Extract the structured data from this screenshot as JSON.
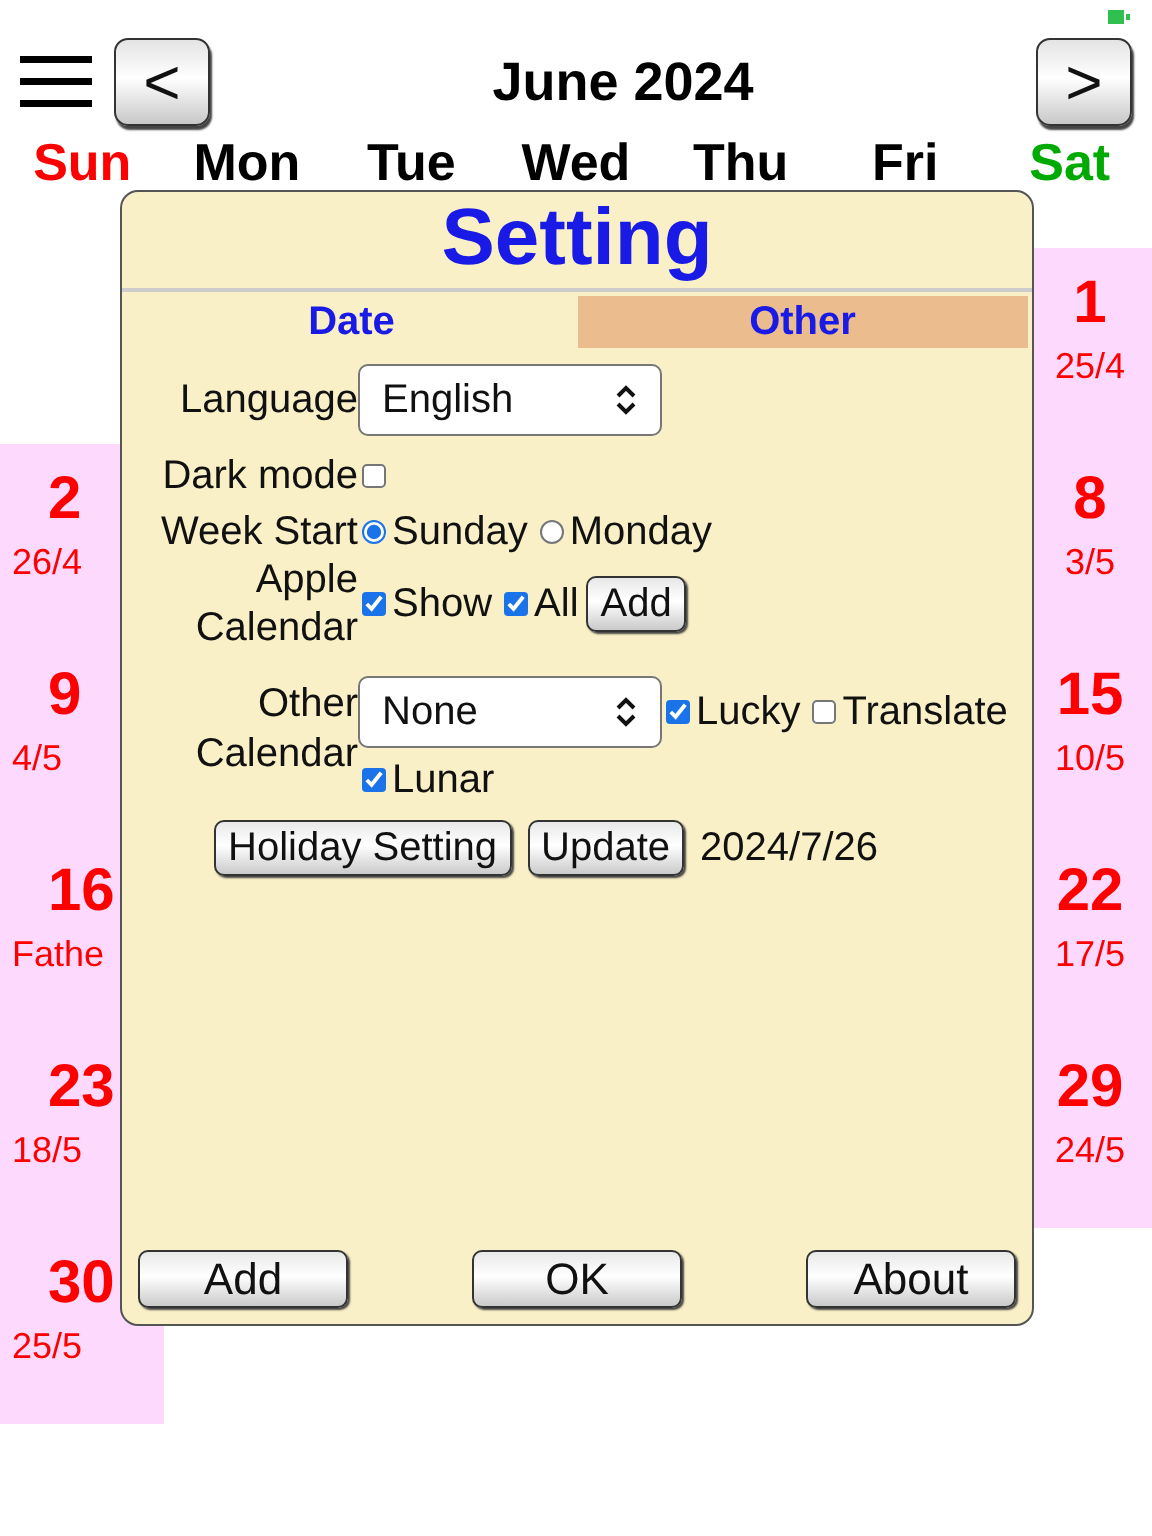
{
  "header": {
    "title": "June 2024",
    "prev": "<",
    "next": ">"
  },
  "weekdays": [
    "Sun",
    "Mon",
    "Tue",
    "Wed",
    "Thu",
    "Fri",
    "Sat"
  ],
  "saturdays": [
    {
      "day": "1",
      "sub": "25/4"
    },
    {
      "day": "8",
      "sub": "3/5"
    },
    {
      "day": "15",
      "sub": "10/5"
    },
    {
      "day": "22",
      "sub": "17/5"
    },
    {
      "day": "29",
      "sub": "24/5"
    }
  ],
  "sundays": [
    {
      "day": "2",
      "sub": "26/4"
    },
    {
      "day": "9",
      "sub": "4/5"
    },
    {
      "day": "16",
      "sub": "Fathe"
    },
    {
      "day": "23",
      "sub": "18/5"
    },
    {
      "day": "30",
      "sub": "25/5"
    }
  ],
  "dialog": {
    "title": "Setting",
    "tabs": [
      {
        "label": "Date",
        "selected": true
      },
      {
        "label": "Other",
        "selected": false
      }
    ],
    "language": {
      "label": "Language",
      "value": "English"
    },
    "dark_mode": {
      "label": "Dark mode",
      "checked": false
    },
    "week_start": {
      "label": "Week Start",
      "options": [
        {
          "label": "Sunday",
          "selected": true
        },
        {
          "label": "Monday",
          "selected": false
        }
      ]
    },
    "apple_calendar": {
      "label": [
        "Apple",
        "Calendar"
      ],
      "show": {
        "label": "Show",
        "checked": true
      },
      "all": {
        "label": "All",
        "checked": true
      },
      "add": "Add"
    },
    "other_calendar": {
      "label": [
        "Other",
        "Calendar"
      ],
      "value": "None",
      "lucky": {
        "label": "Lucky",
        "checked": true
      },
      "translate": {
        "label": "Translate",
        "checked": false
      },
      "lunar": {
        "label": "Lunar",
        "checked": true
      }
    },
    "holiday_button": "Holiday Setting",
    "update_button": "Update",
    "update_date": "2024/7/26",
    "buttons": [
      "Add",
      "OK",
      "About"
    ]
  }
}
